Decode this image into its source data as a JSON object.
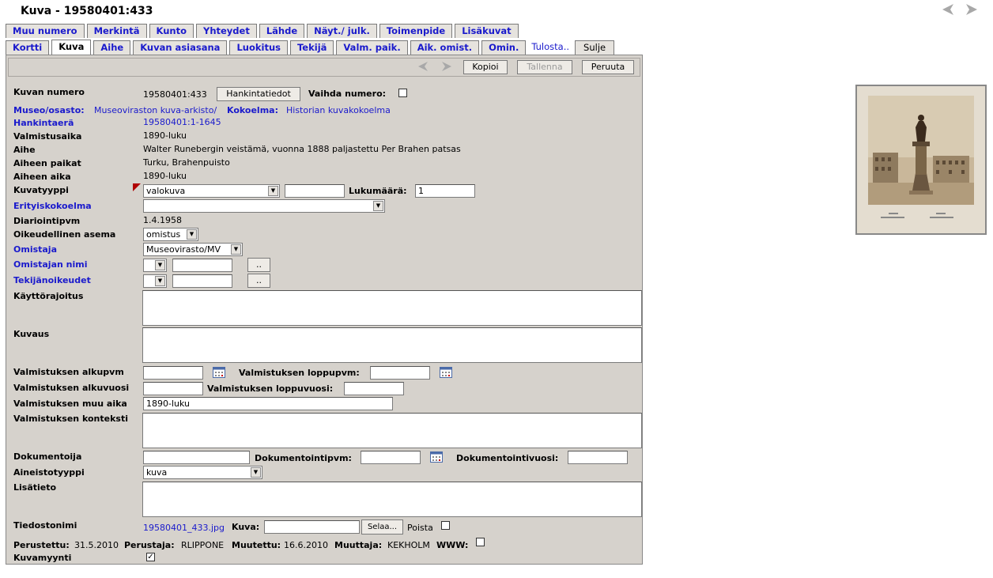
{
  "title": "Kuva - 19580401:433",
  "tabs_row1": [
    "Muu numero",
    "Merkintä",
    "Kunto",
    "Yhteydet",
    "Lähde",
    "Näyt./ julk.",
    "Toimenpide",
    "Lisäkuvat"
  ],
  "tabs_row2": [
    "Kortti",
    "Kuva",
    "Aihe",
    "Kuvan asiasana",
    "Luokitus",
    "Tekijä",
    "Valm. paik.",
    "Aik. omist.",
    "Omin."
  ],
  "tab_print": "Tulosta..",
  "tab_close": "Sulje",
  "toolbar": {
    "copy": "Kopioi",
    "save": "Tallenna",
    "cancel": "Peruuta"
  },
  "fields": {
    "kuvan_numero_label": "Kuvan numero",
    "kuvan_numero_value": "19580401:433",
    "hankintatiedot": "Hankintatiedot",
    "vaihda_numero": "Vaihda numero:",
    "museo_label": "Museo/osasto:",
    "museo_value": "Museoviraston kuva-arkisto/",
    "kokoelma_label": "Kokoelma:",
    "kokoelma_value": "Historian kuvakokoelma",
    "hankintaera_label": "Hankintaerä",
    "hankintaera_value": "19580401:1-1645",
    "valmistusaika_label": "Valmistusaika",
    "valmistusaika_value": "1890-luku",
    "aihe_label": "Aihe",
    "aihe_value": "Walter Runebergin veistämä, vuonna 1888 paljastettu Per Brahen patsas",
    "aiheen_paikat_label": "Aiheen paikat",
    "aiheen_paikat_value": "Turku, Brahenpuisto",
    "aiheen_aika_label": "Aiheen aika",
    "aiheen_aika_value": "1890-luku",
    "kuvatyyppi_label": "Kuvatyyppi",
    "kuvatyyppi_value": "valokuva",
    "lukumaara_label": "Lukumäärä:",
    "lukumaara_value": "1",
    "erityiskokoelma_label": "Erityiskokoelma",
    "diariointipvm_label": "Diariointipvm",
    "diariointipvm_value": "1.4.1958",
    "oikeudellinen_label": "Oikeudellinen asema",
    "oikeudellinen_value": "omistus",
    "omistaja_label": "Omistaja",
    "omistaja_value": "Museovirasto/MV",
    "omistajan_nimi_label": "Omistajan nimi",
    "tekijanoikeudet_label": "Tekijänoikeudet",
    "dots": "..",
    "kayttorajoitus_label": "Käyttörajoitus",
    "kuvaus_label": "Kuvaus",
    "alkupvm_label": "Valmistuksen alkupvm",
    "loppupvm_label": "Valmistuksen loppupvm:",
    "alkuvuosi_label": "Valmistuksen alkuvuosi",
    "loppuvuosi_label": "Valmistuksen loppuvuosi:",
    "muu_aika_label": "Valmistuksen muu aika",
    "muu_aika_value": "1890-luku",
    "konteksti_label": "Valmistuksen konteksti",
    "dokumentoija_label": "Dokumentoija",
    "dokumentointipvm_label": "Dokumentointipvm:",
    "dokumentointivuosi_label": "Dokumentointivuosi:",
    "aineistotyyppi_label": "Aineistotyyppi",
    "aineistotyyppi_value": "kuva",
    "lisatieto_label": "Lisätieto",
    "tiedostonimi_label": "Tiedostonimi",
    "tiedostonimi_value": "19580401_433.jpg",
    "kuva_label": "Kuva:",
    "selaa": "Selaa...",
    "poista": "Poista",
    "perustettu_label": "Perustettu:",
    "perustettu_value": "31.5.2010",
    "perustaja_label": "Perustaja:",
    "perustaja_value": "RLIPPONE",
    "muutettu_label": "Muutettu:",
    "muutettu_value": "16.6.2010",
    "muuttaja_label": "Muuttaja:",
    "muuttaja_value": "KEKHOLM",
    "www_label": "WWW:",
    "kuvamyynti_label": "Kuvamyynti",
    "kuvamyynti_checked": "✓"
  }
}
